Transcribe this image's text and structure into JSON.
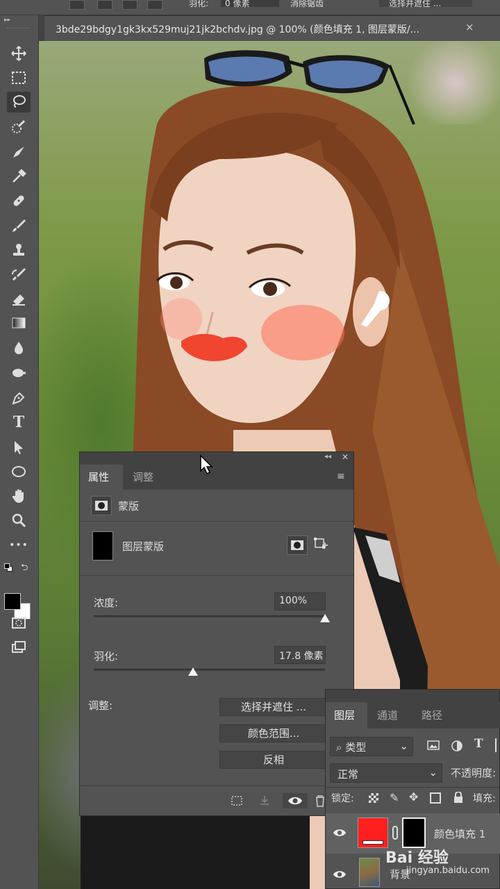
{
  "options_bar": {
    "feather_label": "羽化:",
    "feather_value": "0 像素",
    "antialias_label": "消除锯齿",
    "select_mask_button": "选择并遮住 ..."
  },
  "document": {
    "tab_title": "3bde29bdgy1gk3kx529muj21jk2bchdv.jpg @ 100% (颜色填充 1, 图层蒙版/...",
    "close_symbol": "×"
  },
  "toolbar": {
    "tools": [
      "move-icon",
      "marquee-icon",
      "lasso-icon",
      "quick-selection-icon",
      "crop-icon",
      "eyedropper-icon",
      "healing-brush-icon",
      "brush-icon",
      "clone-stamp-icon",
      "history-brush-icon",
      "eraser-icon",
      "gradient-icon",
      "blur-icon",
      "dodge-icon",
      "pen-icon",
      "type-icon",
      "path-selection-icon",
      "ellipse-icon",
      "hand-icon",
      "zoom-icon",
      "more-icon"
    ],
    "active_tool": "lasso-icon",
    "more_label": "•••",
    "type_label": "T",
    "foreground_color": "#000000",
    "background_color": "#ffffff"
  },
  "properties_panel": {
    "tab_properties": "属性",
    "tab_adjustments": "调整",
    "mask_section_label": "蒙版",
    "layer_mask_label": "图层蒙版",
    "density_label": "浓度:",
    "density_value": "100%",
    "density_fraction": 1.0,
    "feather_label": "羽化:",
    "feather_value": "17.8 像素",
    "feather_fraction": 0.43,
    "adjust_label": "调整:",
    "select_and_mask_button": "选择并遮住 ...",
    "color_range_button": "颜色范围...",
    "invert_button": "反相"
  },
  "layers_panel": {
    "tab_layers": "图层",
    "tab_channels": "通道",
    "tab_paths": "路径",
    "filter_kind": "类型",
    "blend_mode": "正常",
    "opacity_label": "不透明度:",
    "lock_label": "锁定:",
    "fill_label": "填充:",
    "layers": [
      {
        "name": "颜色填充 1",
        "thumb_color": "#ff1f1f"
      },
      {
        "name": "背景"
      }
    ]
  },
  "watermark": {
    "text": "Bai 经验",
    "url": "jingyan.baidu.com"
  }
}
